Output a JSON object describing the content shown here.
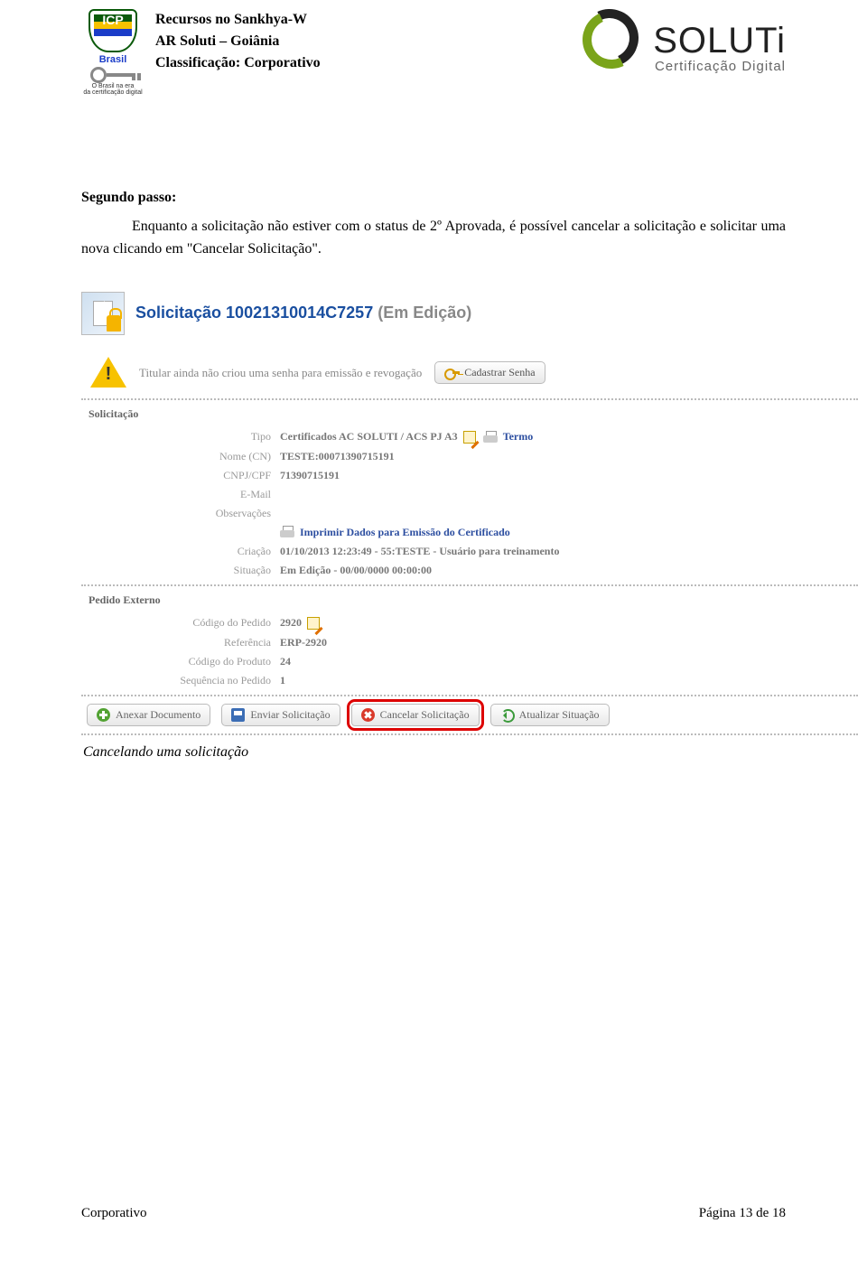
{
  "header": {
    "line1": "Recursos no Sankhya-W",
    "line2": "AR Soluti – Goiânia",
    "line3": "Classificação: Corporativo",
    "icp_brand": "ICP",
    "icp_country": "Brasil",
    "icp_tag1": "O Brasil na era",
    "icp_tag2": "da certificação digital",
    "soluti_name": "SOLUTi",
    "soluti_sub": "Certificação Digital"
  },
  "body": {
    "step_title": "Segundo passo:",
    "paragraph": "Enquanto a solicitação não estiver com o status de 2º Aprovada, é possível cancelar a solicitação e solicitar uma nova clicando em \"Cancelar Solicitação\"."
  },
  "screenshot": {
    "title_prefix": "Solicitação ",
    "title_code": "10021310014C7257",
    "title_status": " (Em Edição)",
    "alert_text": "Titular ainda não criou uma senha para emissão e revogação",
    "btn_cadastrar_senha": "Cadastrar Senha",
    "sec_solicitacao": "Solicitação",
    "rows": {
      "tipo_label": "Tipo",
      "tipo_value": "Certificados AC SOLUTI / ACS PJ A3",
      "termo_link": "Termo",
      "nome_label": "Nome (CN)",
      "nome_value": "TESTE:00071390715191",
      "cnpj_label": "CNPJ/CPF",
      "cnpj_value": "71390715191",
      "email_label": "E-Mail",
      "email_value": "",
      "obs_label": "Observações",
      "obs_value": "",
      "imprimir_link": "Imprimir Dados para Emissão do Certificado",
      "criacao_label": "Criação",
      "criacao_value": "01/10/2013 12:23:49 - 55:TESTE - Usuário para treinamento",
      "situacao_label": "Situação",
      "situacao_value": "Em Edição - 00/00/0000 00:00:00"
    },
    "sec_pedido": "Pedido Externo",
    "pedido": {
      "codigo_label": "Código do Pedido",
      "codigo_value": "2920",
      "ref_label": "Referência",
      "ref_value": "ERP-2920",
      "prod_label": "Código do Produto",
      "prod_value": "24",
      "seq_label": "Sequência no Pedido",
      "seq_value": "1"
    },
    "toolbar": {
      "anexar": "Anexar Documento",
      "enviar": "Enviar Solicitação",
      "cancelar": "Cancelar Solicitação",
      "atualizar": "Atualizar Situação"
    }
  },
  "caption": "Cancelando uma solicitação",
  "footer": {
    "left": "Corporativo",
    "right": "Página 13 de 18"
  }
}
